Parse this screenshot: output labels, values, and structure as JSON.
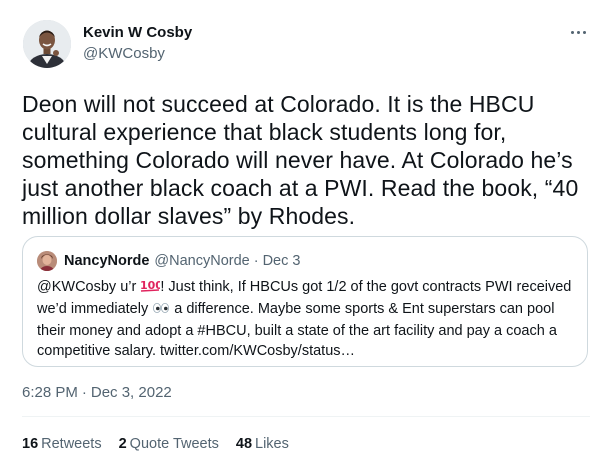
{
  "author": {
    "name": "Kevin W Cosby",
    "handle": "@KWCosby"
  },
  "tweet": {
    "text": "Deon will not succeed at Colorado. It is the HBCU\ncultural experience that black students long for,\nsomething Colorado will never have. At Colorado he’s\njust another black coach at a PWI. Read the book, “40\nmillion dollar slaves” by Rhodes.",
    "timestamp": "6:28 PM",
    "date": "Dec 3, 2022",
    "separator": "·"
  },
  "quote": {
    "name": "NancyNorde",
    "handle": "@NancyNorde",
    "separator": "·",
    "date": "Dec 3",
    "text_1": "@KWCosby u’r ",
    "text_2": "! Just think, If HBCUs got 1/2 of the govt contracts PWI received we’d immediately ",
    "text_3": " a difference. Maybe some sports & Ent superstars can pool their money and adopt a #HBCU, built a state of the art facility and pay a coach a competitive salary. twitter.com/KWCosby/status…"
  },
  "stats": {
    "retweets_count": "16",
    "retweets_label": "Retweets",
    "quotes_count": "2",
    "quotes_label": "Quote Tweets",
    "likes_count": "48",
    "likes_label": "Likes"
  },
  "icons": {
    "more": "more-dots-icon",
    "hundred": "hundred-points-emoji",
    "eyes": "eyes-emoji"
  },
  "colors": {
    "text": "#0f1419",
    "secondary": "#536471",
    "border": "#cfd9de",
    "emoji_red": "#e0245e"
  }
}
